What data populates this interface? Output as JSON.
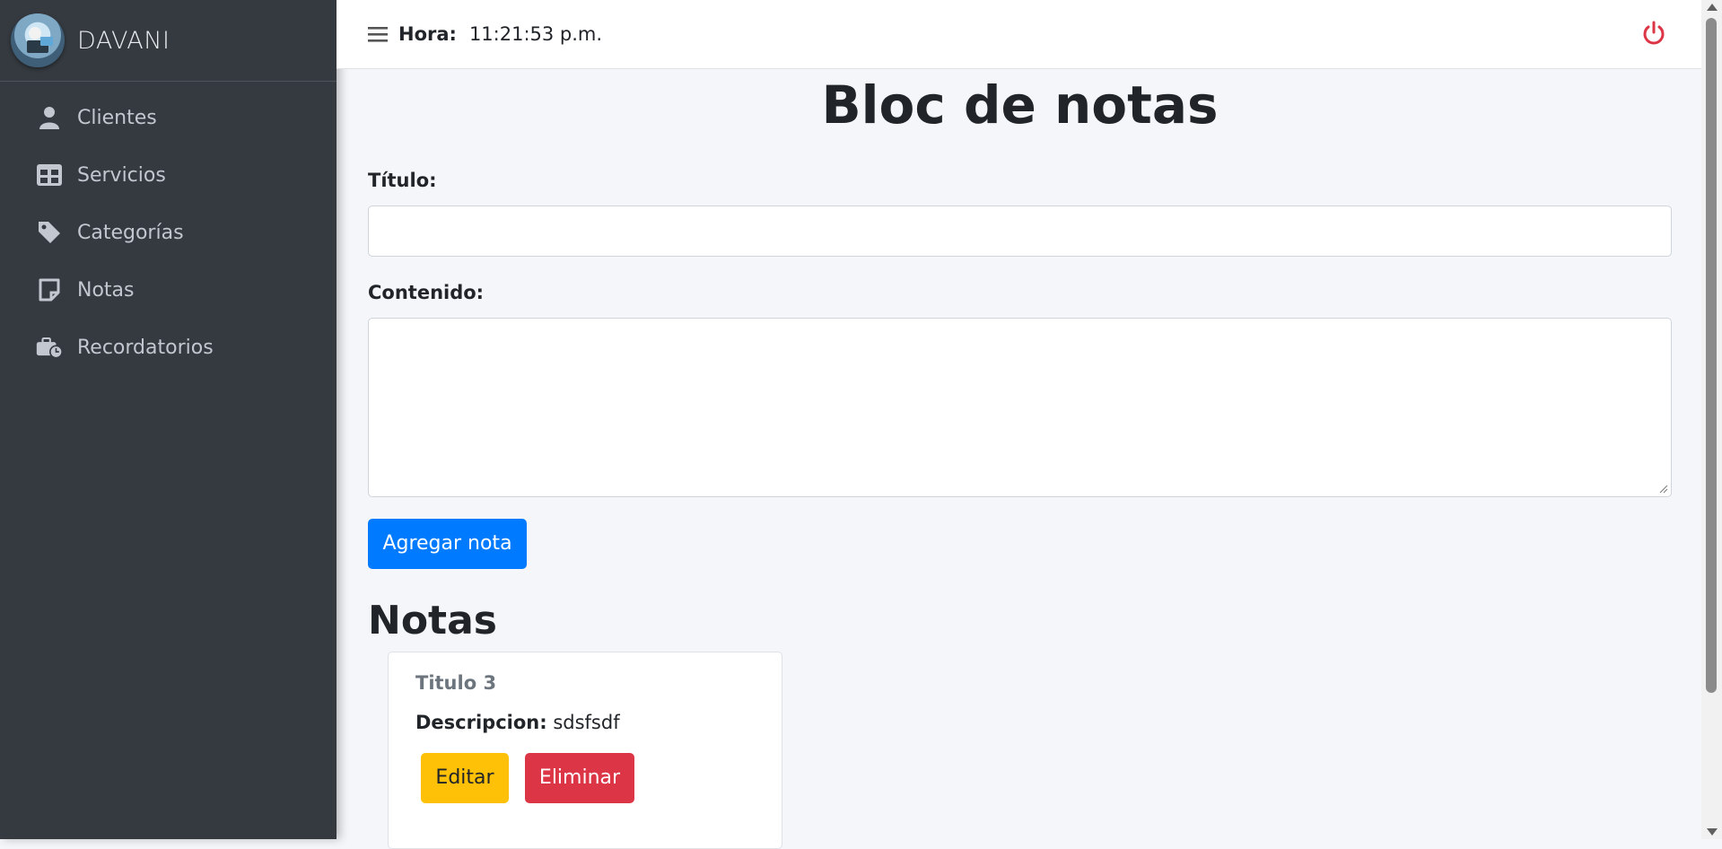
{
  "brand": {
    "name": "DAVANI"
  },
  "sidebar": {
    "items": [
      {
        "label": "Clientes",
        "icon": "user-icon"
      },
      {
        "label": "Servicios",
        "icon": "table-icon"
      },
      {
        "label": "Categorías",
        "icon": "tag-icon"
      },
      {
        "label": "Notas",
        "icon": "note-icon"
      },
      {
        "label": "Recordatorios",
        "icon": "briefcase-clock-icon"
      }
    ]
  },
  "topbar": {
    "hora_label": "Hora:",
    "hora_value": "11:21:53 p.m.",
    "power_color": "#dc3545"
  },
  "main": {
    "title": "Bloc de notas",
    "titulo_label": "Título:",
    "titulo_value": "",
    "contenido_label": "Contenido:",
    "contenido_value": "",
    "add_button": "Agregar nota",
    "notes_heading": "Notas",
    "notes": [
      {
        "title": "Titulo 3",
        "desc_label": "Descripcion:",
        "desc_value": "sdsfsdf",
        "edit_label": "Editar",
        "delete_label": "Eliminar"
      }
    ]
  },
  "colors": {
    "sidebar_bg": "#343a40",
    "primary": "#007bff",
    "warning": "#ffc107",
    "danger": "#dc3545"
  }
}
